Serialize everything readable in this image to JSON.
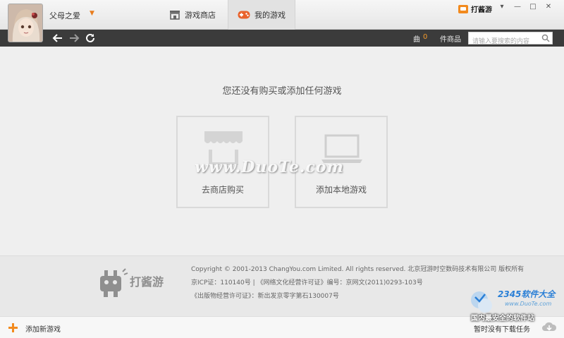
{
  "user": {
    "name": "父母之爱"
  },
  "tabs": [
    {
      "label": "游戏商店",
      "icon": "store-icon",
      "active": false
    },
    {
      "label": "我的游戏",
      "icon": "gamepad-icon",
      "active": true
    }
  ],
  "brand": {
    "name": "打酱游"
  },
  "window_controls": [
    "menu-icon",
    "minimize-icon",
    "maximize-icon",
    "close-icon"
  ],
  "toolbar": {
    "count_label": "曲",
    "count_value": "0",
    "items_label": "件商品",
    "search": {
      "value": "",
      "placeholder": "请输入要搜索的内容"
    }
  },
  "main": {
    "empty_message": "您还没有购买或添加任何游戏",
    "cards": [
      {
        "label": "去商店购买",
        "icon": "store-awning-icon"
      },
      {
        "label": "添加本地游戏",
        "icon": "laptop-icon"
      }
    ],
    "watermark": "www.DuoTe.com"
  },
  "footer": {
    "logo_text": "打酱游",
    "copyright": "Copyright © 2001-2013 ChangYou.com Limited. All rights reserved. 北京冠游时空数码技术有限公司 版权所有",
    "icp": "京ICP证：110140号 | 《网络文化经营许可证》编号：京网文(2011)0293-103号",
    "publication": "《出版物经营许可证》：新出发京零字第石130007号",
    "badge": {
      "title": "2345软件大全",
      "url": "www.DuoTe.com",
      "slogan": "国内最安全的软件站"
    }
  },
  "bottombar": {
    "add_label": "添加新游戏",
    "download_status": "暂时没有下载任务"
  },
  "colors": {
    "accent": "#f39a2b",
    "toolbar": "#3b3b3b"
  }
}
